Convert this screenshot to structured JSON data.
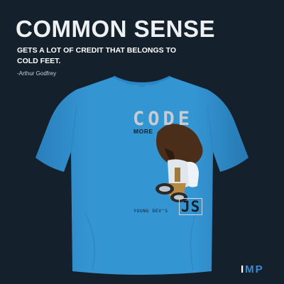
{
  "heading": "COMMON SENSE",
  "quote": "GETS A LOT OF CREDIT THAT BELONGS TO COLD FEET.",
  "author": "-Arthur Godfrey",
  "shirt": {
    "color": "#3391cf",
    "print": {
      "code": "CODE",
      "more": "MORE",
      "young_devs": "YOUNG DEV'S",
      "js": "JS"
    }
  },
  "logo": {
    "lead": "I",
    "rest": "MP"
  },
  "colors": {
    "background": "#14212d",
    "shirt": "#3391cf",
    "logo_accent": "#3a8bd0"
  }
}
